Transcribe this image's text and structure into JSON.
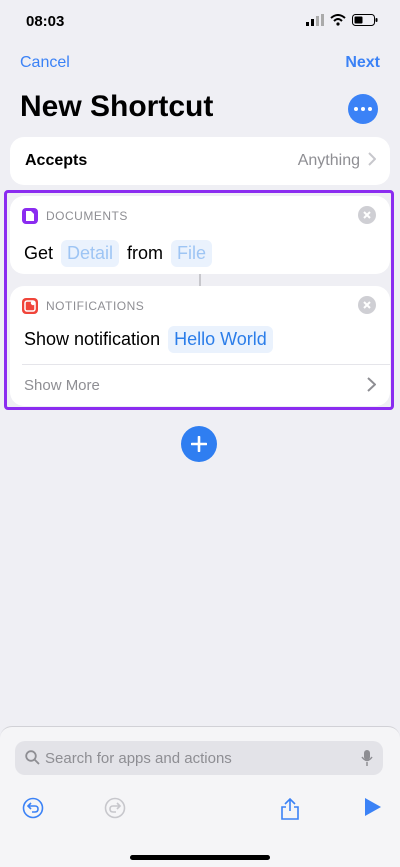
{
  "status": {
    "time": "08:03"
  },
  "nav": {
    "cancel": "Cancel",
    "next": "Next"
  },
  "title": "New Shortcut",
  "accepts": {
    "label": "Accepts",
    "value": "Anything"
  },
  "action1": {
    "category": "DOCUMENTS",
    "verb": "Get",
    "param1": "Detail",
    "connector": "from",
    "param2": "File",
    "color": "#8b2cf0"
  },
  "action2": {
    "category": "NOTIFICATIONS",
    "verb": "Show notification",
    "param": "Hello World",
    "show_more": "Show More",
    "color": "#f0453a"
  },
  "search": {
    "placeholder": "Search for apps and actions"
  },
  "colors": {
    "accent": "#3b82f6",
    "selection": "#8b2cf0"
  }
}
